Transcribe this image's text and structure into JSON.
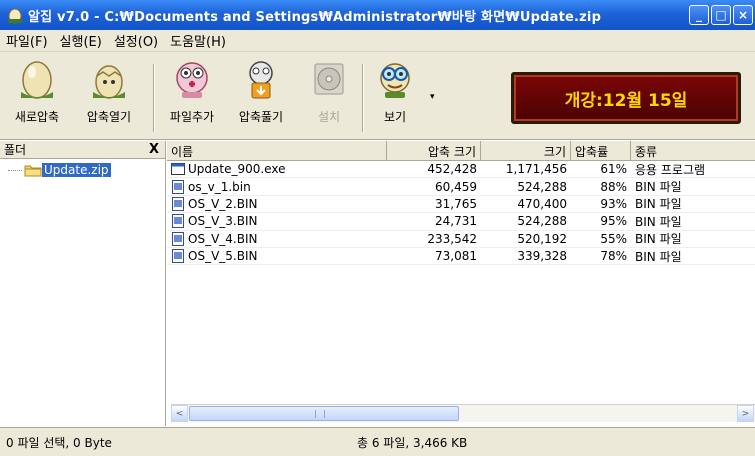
{
  "window": {
    "title": "알집 v7.0 - C:₩Documents and Settings₩Administrator₩바탕 화면₩Update.zip",
    "controls": [
      "_",
      "□",
      "×"
    ]
  },
  "menu": [
    {
      "label": "파일(F)"
    },
    {
      "label": "실행(E)"
    },
    {
      "label": "설정(O)"
    },
    {
      "label": "도움말(H)"
    }
  ],
  "toolbar": {
    "items": [
      {
        "label": "새로압축",
        "icon": "new-archive-egg-icon"
      },
      {
        "label": "압축열기",
        "icon": "open-archive-egg-icon"
      },
      {
        "label": "파일추가",
        "icon": "add-file-icon"
      },
      {
        "label": "압축풀기",
        "icon": "extract-icon"
      },
      {
        "label": "설치",
        "icon": "install-cd-icon",
        "disabled": true
      },
      {
        "label": "보기",
        "icon": "view-icon"
      }
    ],
    "dropdown_arrow": "▾"
  },
  "banner": {
    "text": "개강:12월 15일"
  },
  "folder_panel": {
    "header": "폴더",
    "close": "X",
    "items": [
      {
        "label": "Update.zip"
      }
    ]
  },
  "file_list": {
    "columns": [
      "이름",
      "압축 크기",
      "크기",
      "압축률",
      "종류"
    ],
    "rows": [
      {
        "name": "Update_900.exe",
        "compressed": "452,428",
        "size": "1,171,456",
        "ratio": "61%",
        "type": "응용 프로그램",
        "icon": "exe-icon"
      },
      {
        "name": "os_v_1.bin",
        "compressed": "60,459",
        "size": "524,288",
        "ratio": "88%",
        "type": "BIN 파일",
        "icon": "bin-file-icon"
      },
      {
        "name": "OS_V_2.BIN",
        "compressed": "31,765",
        "size": "470,400",
        "ratio": "93%",
        "type": "BIN 파일",
        "icon": "bin-file-icon"
      },
      {
        "name": "OS_V_3.BIN",
        "compressed": "24,731",
        "size": "524,288",
        "ratio": "95%",
        "type": "BIN 파일",
        "icon": "bin-file-icon"
      },
      {
        "name": "OS_V_4.BIN",
        "compressed": "233,542",
        "size": "520,192",
        "ratio": "55%",
        "type": "BIN 파일",
        "icon": "bin-file-icon"
      },
      {
        "name": "OS_V_5.BIN",
        "compressed": "73,081",
        "size": "339,328",
        "ratio": "78%",
        "type": "BIN 파일",
        "icon": "bin-file-icon"
      }
    ]
  },
  "scrollbar": {
    "left": "<",
    "right": ">"
  },
  "status": {
    "left": "0 파일 선택, 0 Byte",
    "middle": "총 6 파일, 3,466 KB"
  },
  "colors": {
    "titlebar": "#1e62d8",
    "chrome": "#ece9d8",
    "selection": "#316ac5",
    "banner_bg": "#6a0404",
    "banner_text": "#ffd700"
  }
}
